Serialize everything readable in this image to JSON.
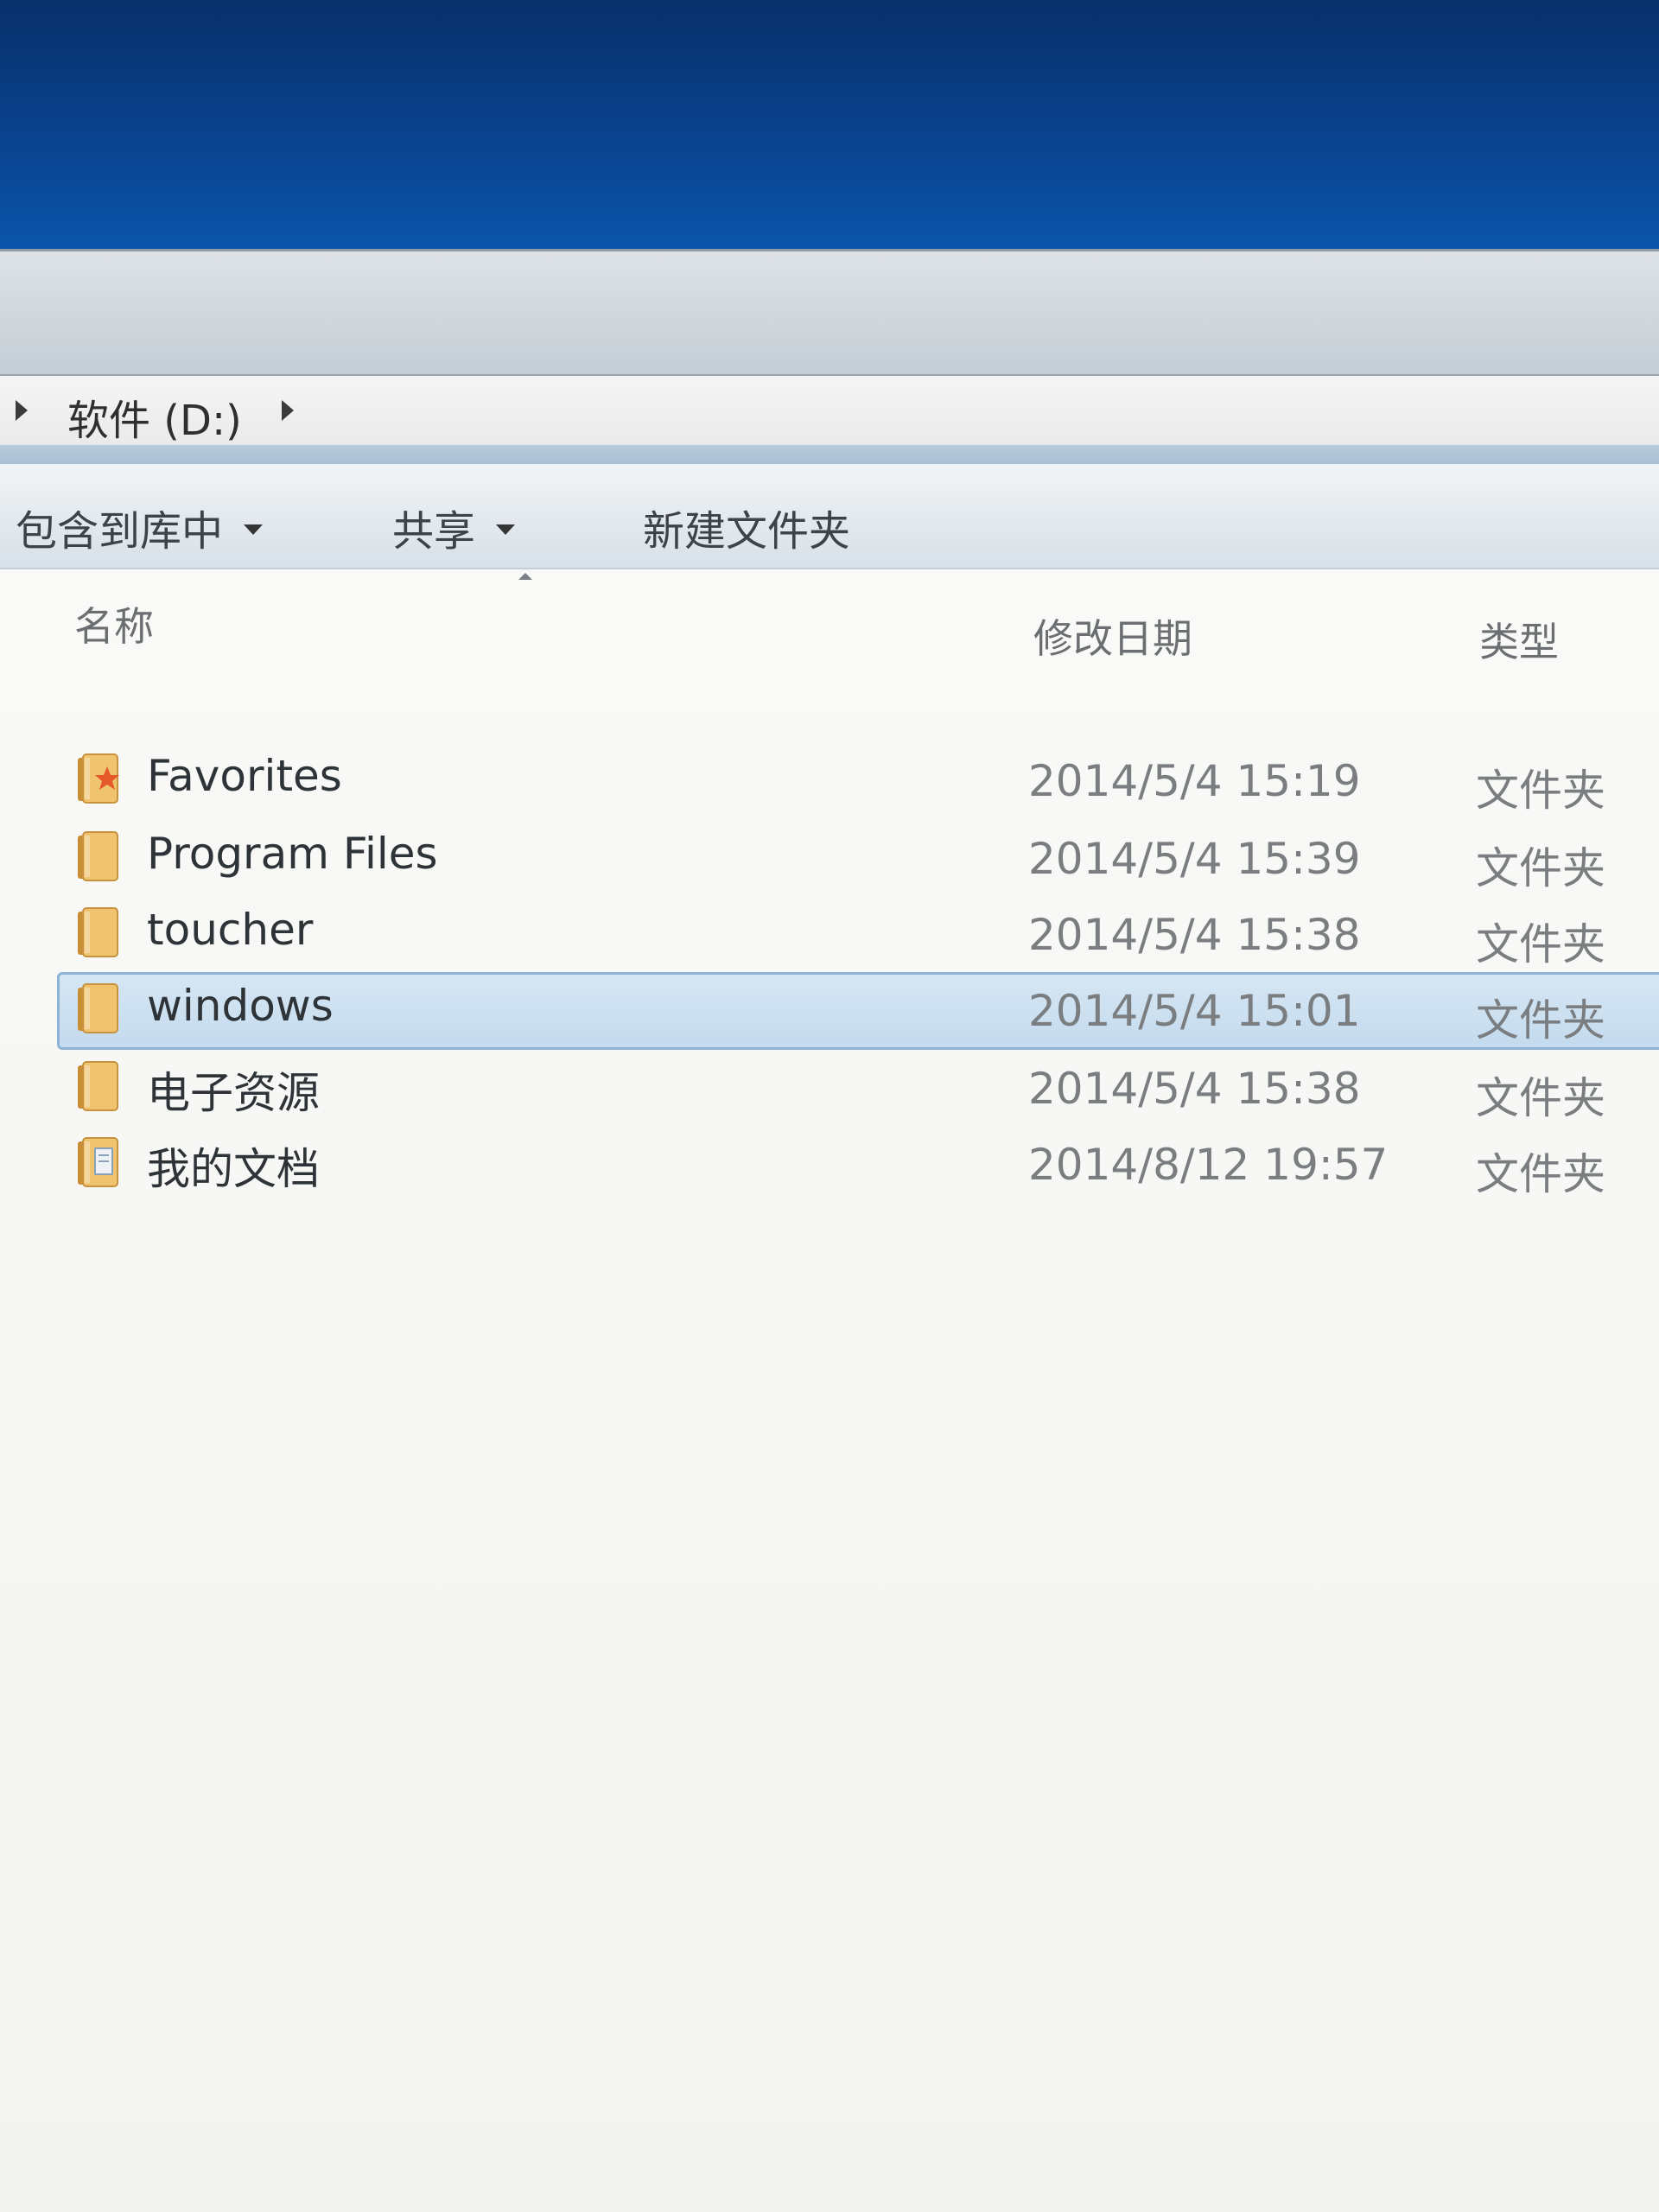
{
  "breadcrumb": {
    "location": "软件 (D:)"
  },
  "toolbar": {
    "include_library": "包含到库中",
    "share": "共享",
    "new_folder": "新建文件夹"
  },
  "columns": {
    "name": "名称",
    "modified": "修改日期",
    "type": "类型"
  },
  "rows": [
    {
      "name": "Favorites",
      "date": "2014/5/4 15:19",
      "type": "文件夹",
      "icon": "favorites-folder-icon"
    },
    {
      "name": "Program Files",
      "date": "2014/5/4 15:39",
      "type": "文件夹",
      "icon": "folder-icon"
    },
    {
      "name": "toucher",
      "date": "2014/5/4 15:38",
      "type": "文件夹",
      "icon": "folder-icon"
    },
    {
      "name": "windows",
      "date": "2014/5/4 15:01",
      "type": "文件夹",
      "icon": "folder-icon",
      "selected": true
    },
    {
      "name": "电子资源",
      "date": "2014/5/4 15:38",
      "type": "文件夹",
      "icon": "folder-icon"
    },
    {
      "name": "我的文档",
      "date": "2014/8/12 19:57",
      "type": "文件夹",
      "icon": "documents-folder-icon"
    }
  ],
  "colors": {
    "desktop": "#0a4593",
    "selection": "#c4dbee",
    "folder": "#e4b25a"
  }
}
